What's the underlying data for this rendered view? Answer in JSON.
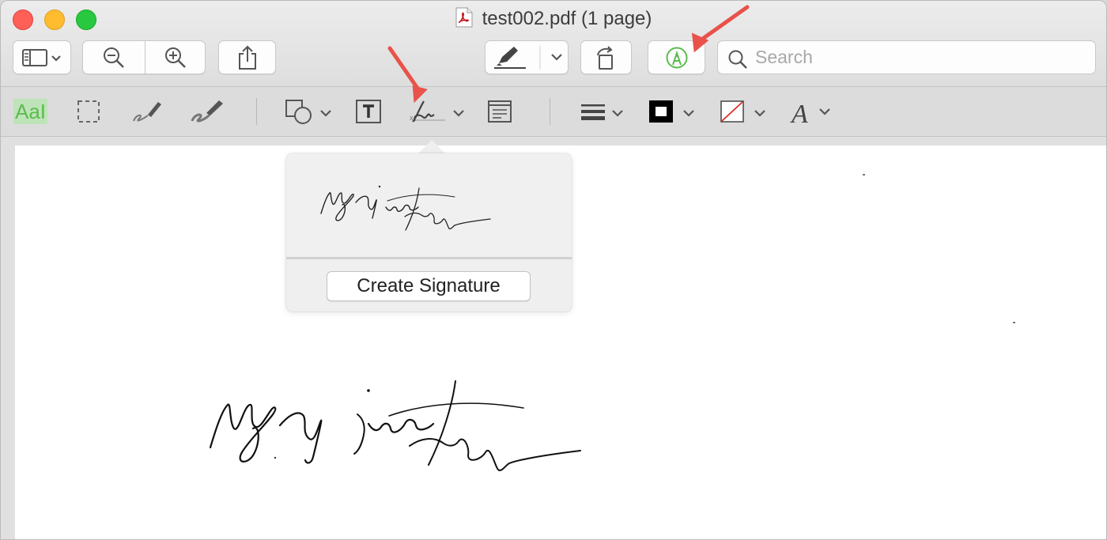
{
  "window": {
    "title": "test002.pdf (1 page)"
  },
  "toolbar": {
    "search_placeholder": "Search",
    "buttons": [
      "sidebar-toggle",
      "zoom-out",
      "zoom-in",
      "share",
      "highlight",
      "rotate",
      "markup-toolbar"
    ]
  },
  "markup_toolbar": {
    "text_selection_label": "AaI",
    "tools": [
      "text-selection",
      "rectangular-selection",
      "sketch",
      "draw",
      "shapes",
      "text-box",
      "sign",
      "note",
      "shape-style",
      "border-color",
      "fill-color",
      "text-style"
    ]
  },
  "signature_popover": {
    "create_button": "Create Signature"
  },
  "colors": {
    "markup_active": "#5cbc4f",
    "annotation_arrow": "#e8524a",
    "border_color_swatch": "#000000",
    "fill_color_slash": "#e0231c"
  }
}
